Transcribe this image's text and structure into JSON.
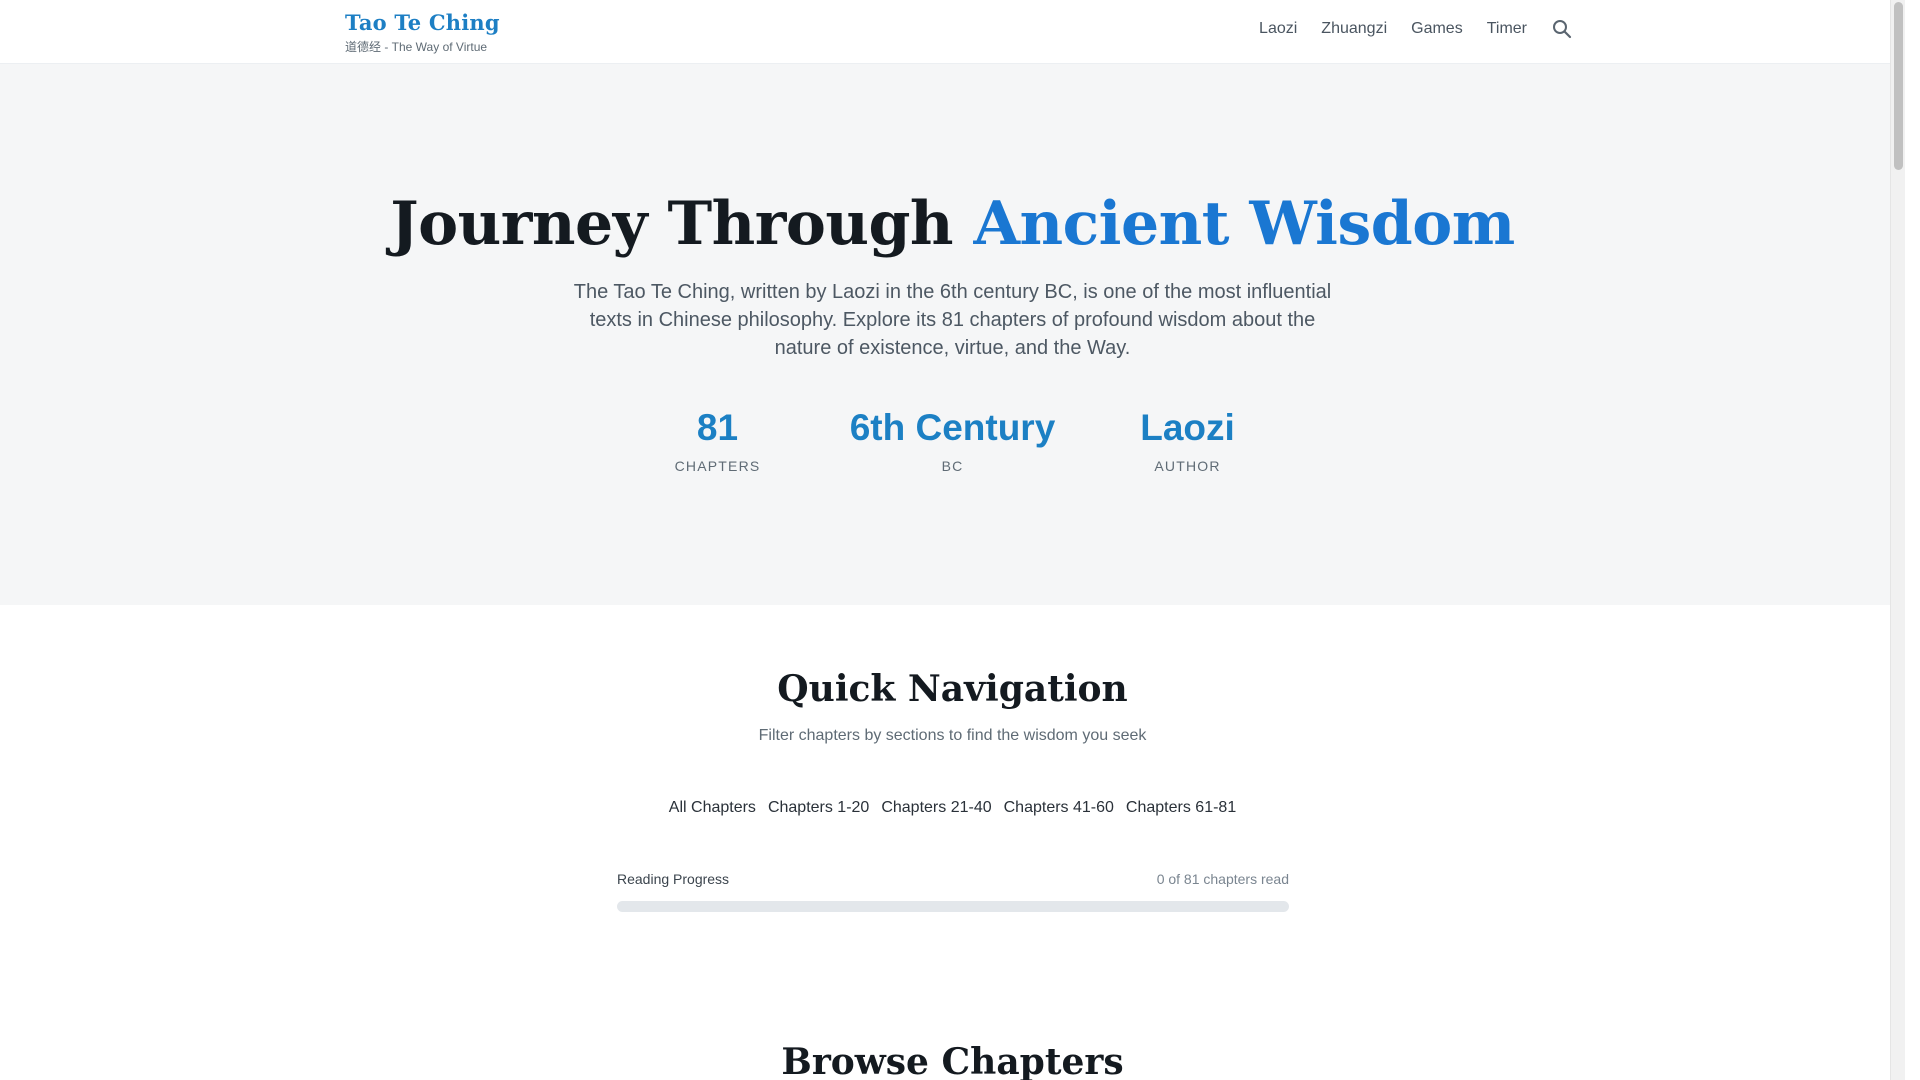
{
  "header": {
    "title": "Tao Te Ching",
    "subtitle": "道德经 - The Way of Virtue",
    "nav": [
      {
        "label": "Laozi"
      },
      {
        "label": "Zhuangzi"
      },
      {
        "label": "Games"
      },
      {
        "label": "Timer"
      }
    ],
    "search_icon": "search-icon"
  },
  "hero": {
    "title_main": "Journey Through ",
    "title_accent": "Ancient Wisdom",
    "description": "The Tao Te Ching, written by Laozi in the 6th century BC, is one of the most influential texts in Chinese philosophy. Explore its 81 chapters of profound wisdom about the nature of existence, virtue, and the Way.",
    "stats": [
      {
        "value": "81",
        "label": "CHAPTERS"
      },
      {
        "value": "6th Century",
        "label": "BC"
      },
      {
        "value": "Laozi",
        "label": "AUTHOR"
      }
    ]
  },
  "quick_nav": {
    "title": "Quick Navigation",
    "subtitle": "Filter chapters by sections to find the wisdom you seek",
    "filters": [
      "All Chapters",
      "Chapters 1-20",
      "Chapters 21-40",
      "Chapters 41-60",
      "Chapters 61-81"
    ],
    "progress": {
      "label": "Reading Progress",
      "count_text": "0 of 81 chapters read",
      "fraction": 0
    }
  },
  "browse": {
    "title": "Browse Chapters"
  },
  "colors": {
    "accent": "#1a77d2",
    "brand": "#1d7fc4",
    "hero_bg": "#f5f6f7"
  }
}
